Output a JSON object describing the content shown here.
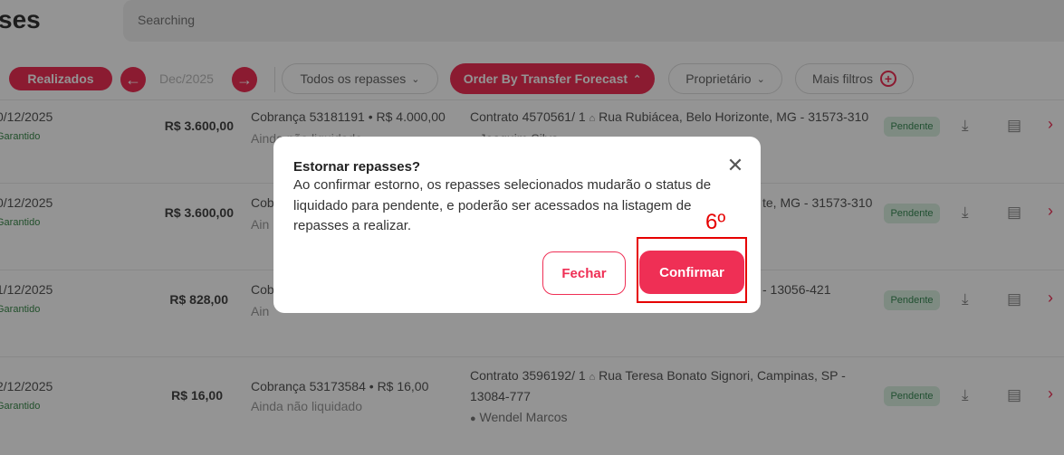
{
  "header": {
    "title": "ses",
    "search_placeholder": "Searching"
  },
  "filters": {
    "realizados": "Realizados",
    "prev_icon": "arrow-left-icon",
    "date": "Dec/2025",
    "next_icon": "arrow-right-icon",
    "todos_repasses": "Todos os repasses",
    "order_by": "Order By Transfer Forecast",
    "proprietario": "Proprietário",
    "mais_filtros": "Mais filtros"
  },
  "rows": [
    {
      "date": "0/12/2025",
      "guarantee": "Garantido",
      "amount": "R$ 3.600,00",
      "charge": "Cobrança 53181191 • R$ 4.000,00",
      "status": "Ainda não liquidado",
      "contract": "Contrato 4570561/ 1",
      "address": "Rua Rubiácea, Belo Horizonte, MG - 31573-310",
      "tenant": "Joaquim Silva",
      "badge": "Pendente"
    },
    {
      "date": "0/12/2025",
      "guarantee": "Garantido",
      "amount": "R$ 3.600,00",
      "charge": "Cob",
      "status": "Ain",
      "contract": "",
      "address": "te, MG - 31573-310",
      "tenant": "",
      "badge": "Pendente"
    },
    {
      "date": "1/12/2025",
      "guarantee": "Garantido",
      "amount": "R$ 828,00",
      "charge": "Cob",
      "status": "Ain",
      "contract": "",
      "address": "- 13056-421",
      "tenant": "",
      "badge": "Pendente"
    },
    {
      "date": "2/12/2025",
      "guarantee": "Garantido",
      "amount": "R$ 16,00",
      "charge": "Cobrança 53173584 • R$ 16,00",
      "status": "Ainda não liquidado",
      "contract": "Contrato 3596192/ 1",
      "address": "Rua Teresa Bonato Signori, Campinas, SP -",
      "address2": "13084-777",
      "tenant": "Wendel Marcos",
      "badge": "Pendente"
    }
  ],
  "modal": {
    "title": "Estornar repasses?",
    "body": "Ao confirmar estorno, os repasses selecionados mudarão o status de liquidado para pendente, e poderão ser acessados na listagem de repasses a realizar.",
    "close_icon": "close-icon",
    "cancel_label": "Fechar",
    "confirm_label": "Confirmar"
  },
  "annotation": {
    "label": "6º",
    "color": "#e60000"
  },
  "colors": {
    "accent": "#ef2f55",
    "overlay": "rgba(0,0,0,0.42)",
    "badge_bg": "#d9efe1"
  }
}
